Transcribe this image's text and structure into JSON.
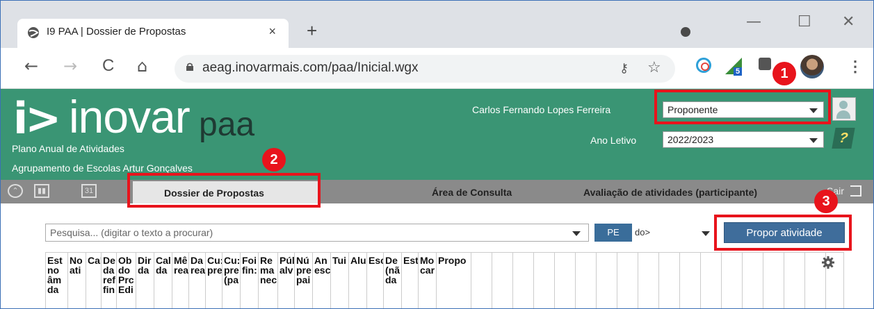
{
  "browser": {
    "tab_title": "I9 PAA | Dossier de Propostas",
    "tab_close": "×",
    "new_tab": "+",
    "url": "aeag.inovarmais.com/paa/Inicial.wgx",
    "extension_badge": "5",
    "window_controls": {
      "minimize": "—",
      "maximize": "☐",
      "close": "✕"
    },
    "nav": {
      "back": "←",
      "forward": "→",
      "reload": "C",
      "home": "⌂"
    }
  },
  "header": {
    "logo_mark": "i>",
    "logo_main": "inovar",
    "logo_sub": "paa",
    "subtitle": "Plano Anual de Atividades",
    "school": "Agrupamento de Escolas Artur Gonçalves",
    "user_name": "Carlos Fernando Lopes Ferreira",
    "role_select": "Proponente",
    "year_label": "Ano Letivo",
    "year_select": "2022/2023",
    "help_label": "?"
  },
  "navbar": {
    "tabs": [
      {
        "label": "Dossier de Propostas"
      },
      {
        "label": "Área de Consulta"
      },
      {
        "label": "Avaliação de atividades (participante)"
      }
    ],
    "logout": "Sair",
    "calendar_label": "31"
  },
  "toolbar": {
    "search_placeholder": "Pesquisa... (digitar o texto a procurar)",
    "pe_button": "PE",
    "pe_select": "do>",
    "propose_button": "Propor atividade"
  },
  "grid": {
    "columns": [
      "Est\nno\nâm\nda",
      "No\nati",
      "Cal",
      "De\nda\nref\nfin",
      "Ob\ndo\nPrc\nEdi",
      "Dir\nda",
      "Cal\nda",
      "Mê\nrea",
      "Da\nrea",
      "Cu:\npre",
      "Cu:\npre\n(pa",
      "Foi\nfin:",
      "Re\nma\nnec",
      "Púl\nalv",
      "Nú\npre\npai",
      "An\nesc",
      "Tui",
      "Alu",
      "Esc",
      "De\n(nã\nda",
      "Est",
      "Mo\ncar",
      "Propo"
    ]
  },
  "callouts": [
    "1",
    "2",
    "3"
  ],
  "colors": {
    "header_green": "#3a9574",
    "navbar_gray": "#8a8a8a",
    "button_blue": "#3f6d9b",
    "callout_red": "#e8141c"
  }
}
